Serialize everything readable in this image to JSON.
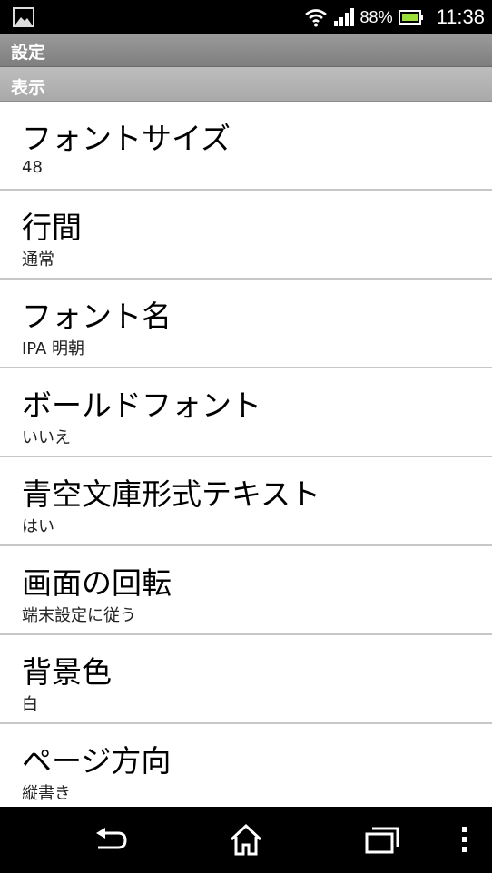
{
  "status_bar": {
    "battery_percent": "88%",
    "time": "11:38"
  },
  "title_bar": {
    "title": "設定"
  },
  "section": {
    "header": "表示"
  },
  "settings": [
    {
      "title": "フォントサイズ",
      "summary": "48"
    },
    {
      "title": "行間",
      "summary": "通常"
    },
    {
      "title": "フォント名",
      "summary": "IPA 明朝"
    },
    {
      "title": "ボールドフォント",
      "summary": "いいえ"
    },
    {
      "title": "青空文庫形式テキスト",
      "summary": "はい"
    },
    {
      "title": "画面の回転",
      "summary": "端末設定に従う"
    },
    {
      "title": "背景色",
      "summary": "白"
    },
    {
      "title": "ページ方向",
      "summary": "縦書き"
    }
  ],
  "icons": {
    "status_left": "gallery-icon",
    "wifi": "wifi-icon",
    "signal": "signal-icon",
    "battery": "battery-icon",
    "nav_back": "back-icon",
    "nav_home": "home-icon",
    "nav_recent": "recent-apps-icon",
    "nav_menu": "menu-icon"
  },
  "colors": {
    "status_bar_bg": "#000000",
    "battery_accent": "#9adf3a",
    "title_bar_bg": "#8c8c8c",
    "section_header_bg": "#b3b3b3",
    "list_bg": "#ffffff",
    "divider": "#c7c7c7"
  }
}
